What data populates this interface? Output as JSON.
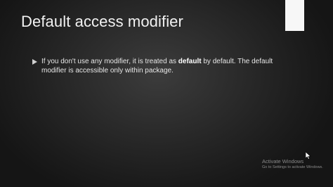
{
  "slide": {
    "title": "Default access modifier",
    "bullet": {
      "text_before": "If you don't use any modifier, it is treated as ",
      "text_bold": "default",
      "text_after": " by default. The default modifier is accessible only within package."
    }
  },
  "watermark": {
    "line1": "Activate Windows",
    "line2": "Go to Settings to activate Windows."
  },
  "icons": {
    "bullet": "triangle-bullet-icon",
    "cursor": "mouse-pointer-icon"
  },
  "colors": {
    "background": "#2a2a2a",
    "accent": "#f7f7f7",
    "text": "#e6e6e6"
  }
}
